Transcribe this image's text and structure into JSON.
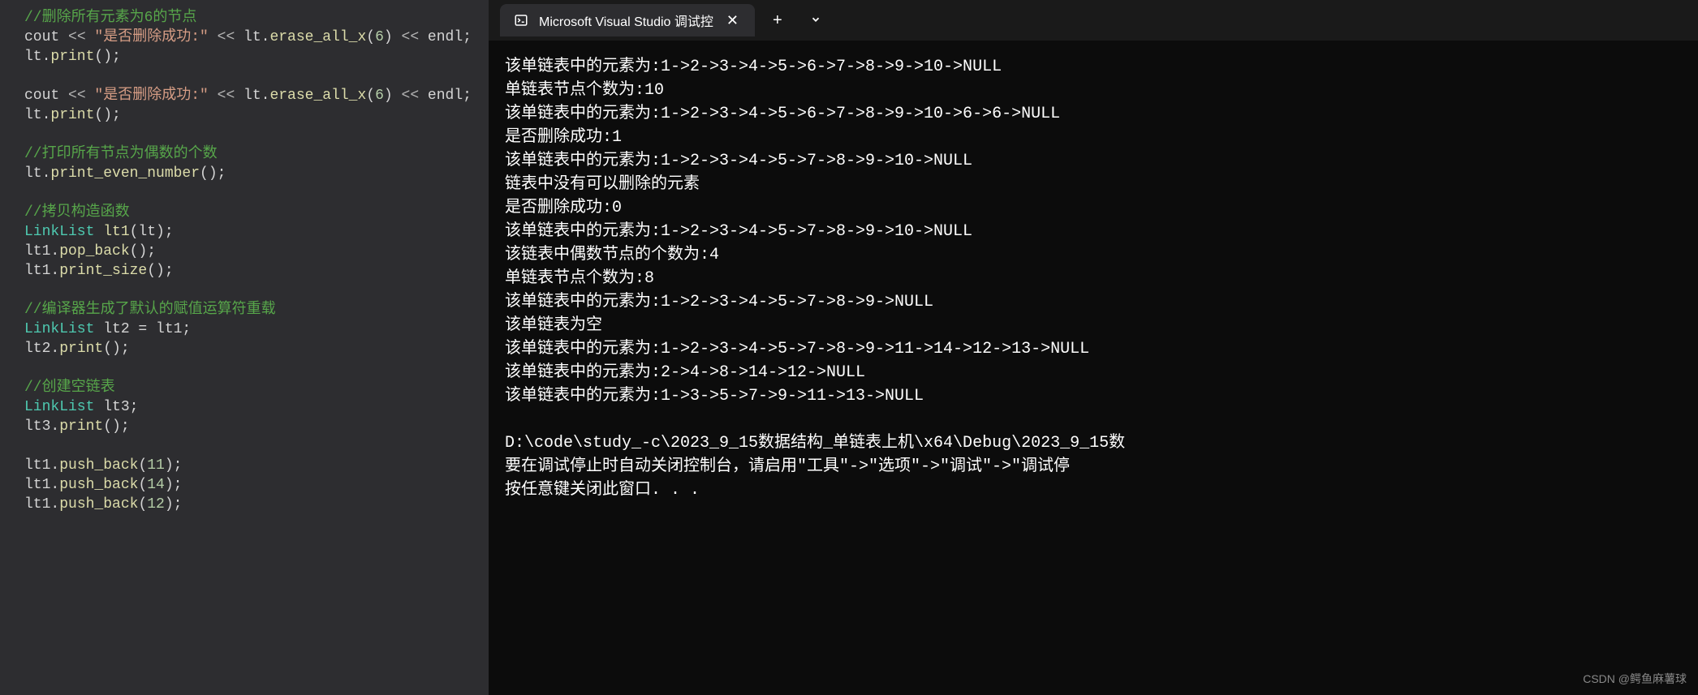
{
  "editor": {
    "lines": [
      {
        "type": "comment",
        "text": "//删除所有元素为6的节点"
      },
      {
        "type": "code",
        "tokens": [
          {
            "cls": "identifier",
            "t": "cout "
          },
          {
            "cls": "operator",
            "t": "<< "
          },
          {
            "cls": "string",
            "t": "\"是否删除成功:\" "
          },
          {
            "cls": "operator",
            "t": "<< "
          },
          {
            "cls": "identifier",
            "t": "lt."
          },
          {
            "cls": "function",
            "t": "erase_all_x"
          },
          {
            "cls": "identifier",
            "t": "("
          },
          {
            "cls": "number",
            "t": "6"
          },
          {
            "cls": "identifier",
            "t": ") "
          },
          {
            "cls": "operator",
            "t": "<< "
          },
          {
            "cls": "identifier",
            "t": "endl;"
          }
        ]
      },
      {
        "type": "code",
        "tokens": [
          {
            "cls": "identifier",
            "t": "lt."
          },
          {
            "cls": "function",
            "t": "print"
          },
          {
            "cls": "identifier",
            "t": "();"
          }
        ]
      },
      {
        "type": "blank"
      },
      {
        "type": "code",
        "tokens": [
          {
            "cls": "identifier",
            "t": "cout "
          },
          {
            "cls": "operator",
            "t": "<< "
          },
          {
            "cls": "string",
            "t": "\"是否删除成功:\" "
          },
          {
            "cls": "operator",
            "t": "<< "
          },
          {
            "cls": "identifier",
            "t": "lt."
          },
          {
            "cls": "function",
            "t": "erase_all_x"
          },
          {
            "cls": "identifier",
            "t": "("
          },
          {
            "cls": "number",
            "t": "6"
          },
          {
            "cls": "identifier",
            "t": ") "
          },
          {
            "cls": "operator",
            "t": "<< "
          },
          {
            "cls": "identifier",
            "t": "endl;"
          }
        ]
      },
      {
        "type": "code",
        "tokens": [
          {
            "cls": "identifier",
            "t": "lt."
          },
          {
            "cls": "function",
            "t": "print"
          },
          {
            "cls": "identifier",
            "t": "();"
          }
        ]
      },
      {
        "type": "blank"
      },
      {
        "type": "comment",
        "text": "//打印所有节点为偶数的个数"
      },
      {
        "type": "code",
        "tokens": [
          {
            "cls": "identifier",
            "t": "lt."
          },
          {
            "cls": "function",
            "t": "print_even_number"
          },
          {
            "cls": "identifier",
            "t": "();"
          }
        ]
      },
      {
        "type": "blank"
      },
      {
        "type": "comment",
        "text": "//拷贝构造函数"
      },
      {
        "type": "code",
        "tokens": [
          {
            "cls": "type",
            "t": "LinkList "
          },
          {
            "cls": "function",
            "t": "lt1"
          },
          {
            "cls": "identifier",
            "t": "(lt);"
          }
        ]
      },
      {
        "type": "code",
        "tokens": [
          {
            "cls": "identifier",
            "t": "lt1."
          },
          {
            "cls": "function",
            "t": "pop_back"
          },
          {
            "cls": "identifier",
            "t": "();"
          }
        ]
      },
      {
        "type": "code",
        "tokens": [
          {
            "cls": "identifier",
            "t": "lt1."
          },
          {
            "cls": "function",
            "t": "print_size"
          },
          {
            "cls": "identifier",
            "t": "();"
          }
        ]
      },
      {
        "type": "blank"
      },
      {
        "type": "comment",
        "text": "//编译器生成了默认的赋值运算符重载"
      },
      {
        "type": "code",
        "tokens": [
          {
            "cls": "type",
            "t": "LinkList "
          },
          {
            "cls": "identifier",
            "t": "lt2 = lt1;"
          }
        ]
      },
      {
        "type": "code",
        "tokens": [
          {
            "cls": "identifier",
            "t": "lt2."
          },
          {
            "cls": "function",
            "t": "print"
          },
          {
            "cls": "identifier",
            "t": "();"
          }
        ]
      },
      {
        "type": "blank"
      },
      {
        "type": "comment",
        "text": "//创建空链表"
      },
      {
        "type": "code",
        "tokens": [
          {
            "cls": "type",
            "t": "LinkList "
          },
          {
            "cls": "identifier",
            "t": "lt3;"
          }
        ]
      },
      {
        "type": "code",
        "tokens": [
          {
            "cls": "identifier",
            "t": "lt3."
          },
          {
            "cls": "function",
            "t": "print"
          },
          {
            "cls": "identifier",
            "t": "();"
          }
        ]
      },
      {
        "type": "blank"
      },
      {
        "type": "code",
        "tokens": [
          {
            "cls": "identifier",
            "t": "lt1."
          },
          {
            "cls": "function",
            "t": "push_back"
          },
          {
            "cls": "identifier",
            "t": "("
          },
          {
            "cls": "number",
            "t": "11"
          },
          {
            "cls": "identifier",
            "t": ");"
          }
        ]
      },
      {
        "type": "code",
        "tokens": [
          {
            "cls": "identifier",
            "t": "lt1."
          },
          {
            "cls": "function",
            "t": "push_back"
          },
          {
            "cls": "identifier",
            "t": "("
          },
          {
            "cls": "number",
            "t": "14"
          },
          {
            "cls": "identifier",
            "t": ");"
          }
        ]
      },
      {
        "type": "code",
        "tokens": [
          {
            "cls": "identifier",
            "t": "lt1."
          },
          {
            "cls": "function",
            "t": "push_back"
          },
          {
            "cls": "identifier",
            "t": "("
          },
          {
            "cls": "number",
            "t": "12"
          },
          {
            "cls": "identifier",
            "t": ");"
          }
        ]
      }
    ]
  },
  "terminal": {
    "tab_title": "Microsoft Visual Studio 调试控",
    "output": [
      "该单链表中的元素为:1->2->3->4->5->6->7->8->9->10->NULL",
      "单链表节点个数为:10",
      "该单链表中的元素为:1->2->3->4->5->6->7->8->9->10->6->6->NULL",
      "是否删除成功:1",
      "该单链表中的元素为:1->2->3->4->5->7->8->9->10->NULL",
      "链表中没有可以删除的元素",
      "是否删除成功:0",
      "该单链表中的元素为:1->2->3->4->5->7->8->9->10->NULL",
      "该链表中偶数节点的个数为:4",
      "单链表节点个数为:8",
      "该单链表中的元素为:1->2->3->4->5->7->8->9->NULL",
      "该单链表为空",
      "该单链表中的元素为:1->2->3->4->5->7->8->9->11->14->12->13->NULL",
      "该单链表中的元素为:2->4->8->14->12->NULL",
      "该单链表中的元素为:1->3->5->7->9->11->13->NULL",
      "",
      "D:\\code\\study_-c\\2023_9_15数据结构_单链表上机\\x64\\Debug\\2023_9_15数",
      "要在调试停止时自动关闭控制台，请启用\"工具\"->\"选项\"->\"调试\"->\"调试停",
      "按任意键关闭此窗口. . ."
    ]
  },
  "watermark": "CSDN @鳄鱼麻薯球"
}
